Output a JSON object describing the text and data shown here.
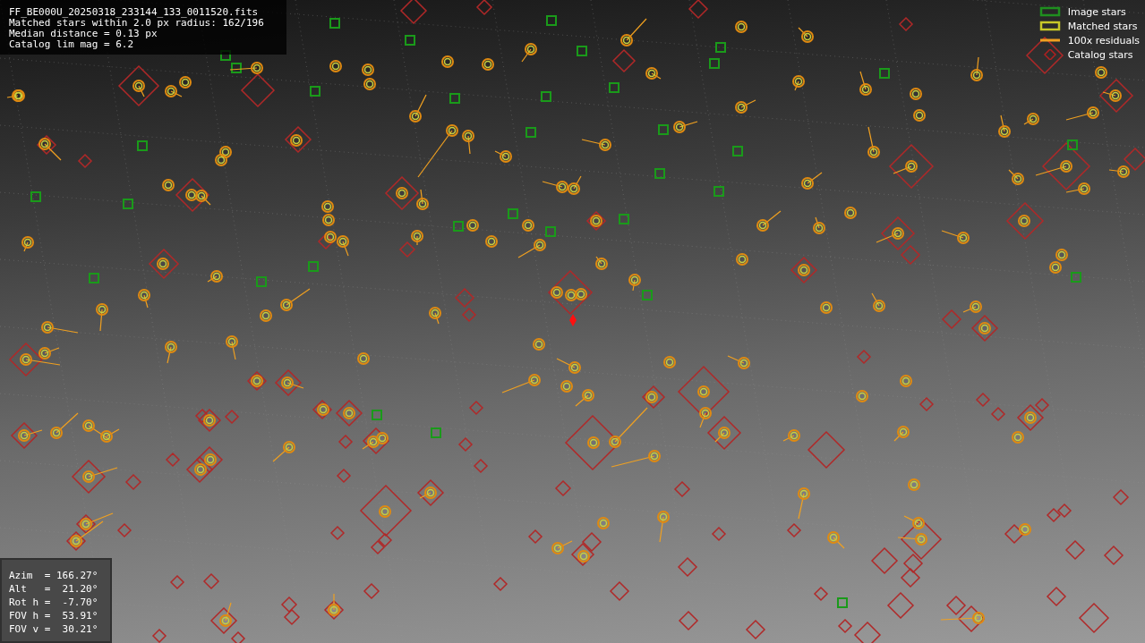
{
  "image": {
    "info_lines": [
      "FF_BE000U_20250318_233144_133_0011520.fits",
      "Matched stars within 2.0 px radius: 162/196",
      "Median distance = 0.13 px",
      "Catalog lim mag = 6.2"
    ],
    "legend": [
      {
        "kind": "box",
        "label": "Image stars",
        "color": "#1f8f1f"
      },
      {
        "kind": "box",
        "label": "Matched stars",
        "color": "#c8c828"
      },
      {
        "kind": "line",
        "label": "100x residuals",
        "color": "#f0a020"
      },
      {
        "kind": "diamond",
        "label": "Catalog stars",
        "color": "#b02020"
      }
    ],
    "pointing": [
      "Azim  = 166.27°",
      "Alt   =  21.20°",
      "Rot h =  -7.70°",
      "FOV h =  53.91°",
      "FOV v =  30.21°"
    ]
  }
}
